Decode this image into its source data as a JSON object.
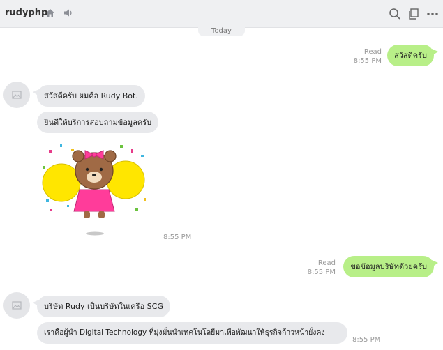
{
  "header": {
    "title": "rudyphp",
    "icons": {
      "home": "home-icon",
      "mute": "speaker-icon",
      "search": "search-icon",
      "notes": "notes-icon",
      "more": "more-icon"
    }
  },
  "date_separator": "Today",
  "colors": {
    "outgoing_bubble": "#b8ef88",
    "incoming_bubble": "#e8e9ec",
    "header_bg": "#eff0f2"
  },
  "messages": [
    {
      "from": "me",
      "text": "สวัสดีครับ",
      "read_label": "Read",
      "time": "8:55 PM"
    },
    {
      "from": "bot",
      "text": "สวัสดีครับ ผมคือ Rudy Bot."
    },
    {
      "from": "bot",
      "text": "ยินดีให้บริการสอบถามข้อมูลครับ"
    },
    {
      "from": "bot",
      "type": "sticker",
      "sticker": "cheerleader-bear-sticker",
      "time": "8:55 PM"
    },
    {
      "from": "me",
      "text": "ขอข้อมูลบริษัทด้วยครับ",
      "read_label": "Read",
      "time": "8:55 PM"
    },
    {
      "from": "bot",
      "text": "บริษัท Rudy เป็นบริษัทในเครือ SCG"
    },
    {
      "from": "bot",
      "text": "เราคือผู้นำ Digital Technology ที่มุ่งมั่นนำเทคโนโลยีมาเพื่อพัฒนาให้ธุรกิจก้าวหน้ายั่งคง",
      "time": "8:55 PM"
    }
  ]
}
